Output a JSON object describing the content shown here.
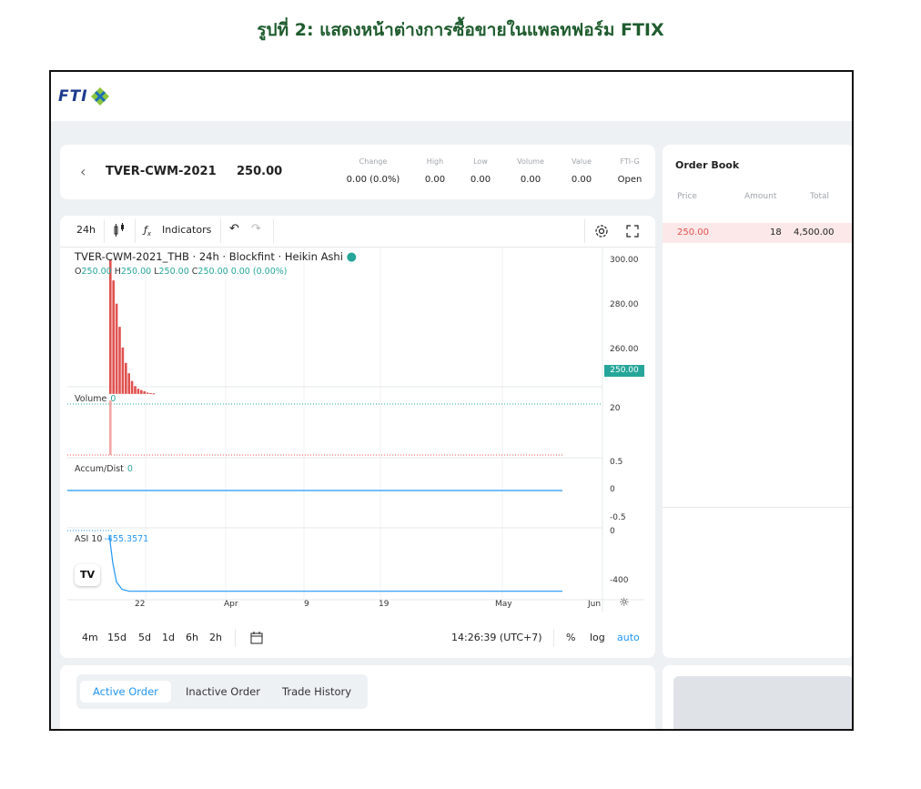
{
  "caption": "รูปที่ 2: แสดงหน้าต่างการซื้อขายในแพลทฟอร์ม FTIX",
  "brand": {
    "logo_text": "FTI",
    "accent": "#26a69a",
    "brand_color": "#1d3b8f",
    "logo_x_color": "#8bc53f"
  },
  "header": {
    "back_icon": "chevron-left-icon",
    "pair": "TVER-CWM-2021",
    "last_price": "250.00",
    "stats": [
      {
        "label": "Change",
        "value": "0.00 (0.0%)"
      },
      {
        "label": "High",
        "value": "0.00"
      },
      {
        "label": "Low",
        "value": "0.00"
      },
      {
        "label": "Volume",
        "value": "0.00"
      },
      {
        "label": "Value",
        "value": "0.00"
      },
      {
        "label": "FTI-G",
        "value": "Open"
      }
    ]
  },
  "chart_toolbar": {
    "interval": "24h",
    "candle_icon": "candlestick-icon",
    "fx_icon": "fx-icon",
    "indicators_label": "Indicators",
    "undo_icon": "undo-icon",
    "redo_icon": "redo-icon",
    "settings_icon": "gear-icon",
    "fullscreen_icon": "fullscreen-icon"
  },
  "chart": {
    "title": "TVER-CWM-2021_THB · 24h · Blockfint · Heikin Ashi",
    "ohlc": {
      "o_label": "O",
      "o": "250.00",
      "h_label": "H",
      "h": "250.00",
      "l_label": "L",
      "l": "250.00",
      "c_label": "C",
      "c": "250.00",
      "change": "0.00 (0.00%)"
    },
    "price_ticks": [
      "300.00",
      "280.00",
      "260.00"
    ],
    "price_tag": "250.00",
    "volume_label": "Volume",
    "volume_value": "0",
    "volume_tick": "20",
    "accum_label": "Accum/Dist",
    "accum_value": "0",
    "accum_ticks": [
      "0.5",
      "0",
      "-0.5"
    ],
    "asi_label": "ASI 10",
    "asi_value": "-455.3571",
    "asi_ticks": [
      "0",
      "-400"
    ],
    "x_ticks": [
      "22",
      "Apr",
      "9",
      "19",
      "May",
      "Jun"
    ],
    "tv_logo": "TV"
  },
  "chart_data": {
    "type": "bar",
    "title": "TVER-CWM-2021_THB · 24h · Blockfint · Heikin Ashi",
    "price_candles": {
      "ylim": [
        245,
        305
      ],
      "values": [
        302,
        294,
        285,
        276,
        268,
        262,
        258,
        255,
        253,
        252,
        251.5,
        251,
        250.5,
        250.3,
        250.2
      ]
    },
    "volume": {
      "values": [
        22
      ]
    },
    "asi": {
      "ylim": [
        -450,
        20
      ],
      "values": [
        0,
        -230,
        -380,
        -440,
        -455,
        -455,
        -455
      ]
    }
  },
  "bottom_bar": {
    "ranges": [
      "4m",
      "15d",
      "5d",
      "1d",
      "6h",
      "2h"
    ],
    "calendar_icon": "calendar-range-icon",
    "time": "14:26:39 (UTC+7)",
    "percent": "%",
    "log": "log",
    "auto": "auto"
  },
  "order_book": {
    "title": "Order Book",
    "columns": [
      "Price",
      "Amount",
      "Total"
    ],
    "rows": [
      {
        "price": "250.00",
        "amount": "18",
        "total": "4,500.00"
      }
    ]
  },
  "orders": {
    "tabs": [
      "Active Order",
      "Inactive Order",
      "Trade History"
    ]
  }
}
